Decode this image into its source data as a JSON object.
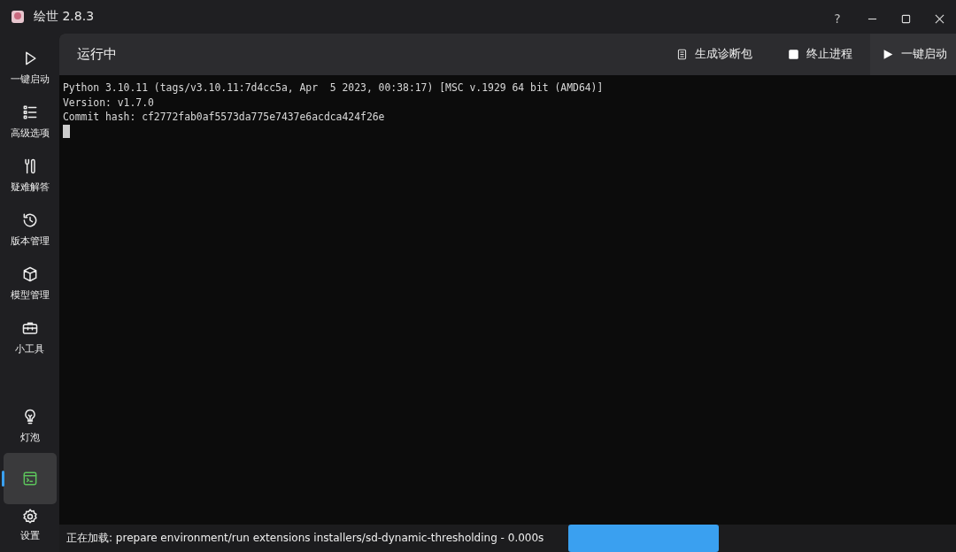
{
  "window": {
    "title": "绘世 2.8.3",
    "controls": [
      "?"
    ]
  },
  "sidebar": {
    "items": [
      {
        "label": "一键启动",
        "selected": false
      },
      {
        "label": "高级选项",
        "selected": false
      },
      {
        "label": "疑难解答",
        "selected": false
      },
      {
        "label": "版本管理",
        "selected": false
      },
      {
        "label": "模型管理",
        "selected": false
      },
      {
        "label": "小工具",
        "selected": false
      }
    ],
    "bottom_items": [
      {
        "label": "灯泡",
        "selected": false
      },
      {
        "selected": true
      },
      {
        "label": "设置",
        "selected": false
      }
    ]
  },
  "header": {
    "title": "运行中",
    "actions": [
      "生成诊断包",
      "终止进程",
      "一键启动"
    ]
  },
  "console": {
    "lines": [
      "Python 3.10.11 (tags/v3.10.11:7d4cc5a, Apr  5 2023, 00:38:17) [MSC v.1929 64 bit (AMD64)]",
      "Version: v1.7.0",
      "Commit hash: cf2772fab0af5573da775e7437e6acdca424f26e"
    ]
  },
  "status_bar": {
    "text": "正在加载: prepare environment/run extensions installers/sd-dynamic-thresholding - 0.000s"
  }
}
